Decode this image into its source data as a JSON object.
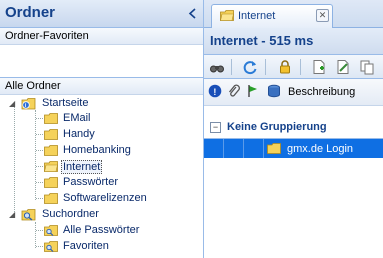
{
  "left_panel": {
    "title": "Ordner",
    "favorites_header": "Ordner-Favoriten",
    "all_header": "Alle Ordner",
    "tree": {
      "root1": "Startseite",
      "children1": [
        "EMail",
        "Handy",
        "Homebanking",
        "Internet",
        "Passwörter",
        "Softwarelizenzen"
      ],
      "root2": "Suchordner",
      "children2": [
        "Alle Passwörter",
        "Favoriten"
      ]
    }
  },
  "right_panel": {
    "tab_label": "Internet",
    "title": "Internet - 515 ms",
    "column_header": "Beschreibung",
    "group_label": "Keine Gruppierung",
    "row_label": "gmx.de Login"
  },
  "colors": {
    "accent": "#15428b",
    "selected_row": "#0f6fe3",
    "folder": "#f5d25a"
  }
}
